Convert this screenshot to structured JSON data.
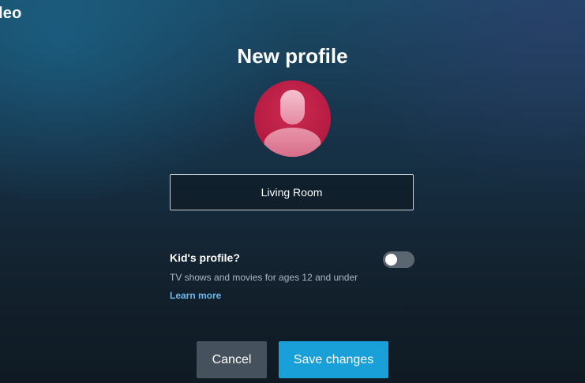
{
  "app": {
    "logo_text": "leo"
  },
  "page": {
    "title": "New profile"
  },
  "avatar": {
    "icon": "person-avatar-icon",
    "color": "#b81d43"
  },
  "name_field": {
    "value": "Living Room",
    "placeholder": ""
  },
  "kids_profile": {
    "label": "Kid's profile?",
    "description": "TV shows and movies for ages 12 and under",
    "learn_more": "Learn more",
    "enabled": false
  },
  "buttons": {
    "cancel_label": "Cancel",
    "save_label": "Save changes"
  },
  "colors": {
    "accent": "#1aa0d8",
    "link": "#68b7e8",
    "cancel_bg": "#45525d"
  }
}
